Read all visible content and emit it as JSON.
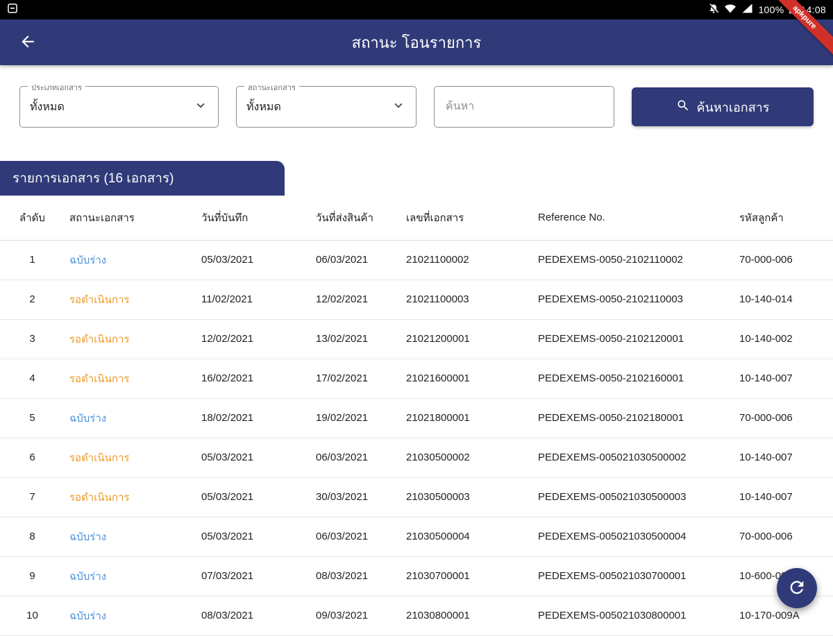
{
  "status_bar": {
    "battery_pct": "100%",
    "time": "14:08"
  },
  "ribbon": {
    "text": "apkpure"
  },
  "app_bar": {
    "title": "สถานะ โอนรายการ"
  },
  "filters": {
    "doc_type": {
      "label": "ประเภทเอกสาร",
      "value": "ทั้งหมด"
    },
    "doc_status": {
      "label": "สถานะเอกสาร",
      "value": "ทั้งหมด"
    },
    "search_placeholder": "ค้นหา",
    "search_button": "ค้นหาเอกสาร"
  },
  "section": {
    "title": "รายการเอกสาร (16 เอกสาร)"
  },
  "table": {
    "headers": [
      "ลำดับ",
      "สถานะเอกสาร",
      "วันที่บันทึก",
      "วันที่ส่งสินค้า",
      "เลขที่เอกสาร",
      "Reference No.",
      "รหัสลูกค้า"
    ],
    "rows": [
      {
        "no": "1",
        "status": "ฉบับร่าง",
        "status_type": "draft",
        "record_date": "05/03/2021",
        "ship_date": "06/03/2021",
        "doc_no": "21021100002",
        "reference": "PEDEXEMS-0050-2102110002",
        "customer": "70-000-006"
      },
      {
        "no": "2",
        "status": "รอดำเนินการ",
        "status_type": "pending",
        "record_date": "11/02/2021",
        "ship_date": "12/02/2021",
        "doc_no": "21021100003",
        "reference": "PEDEXEMS-0050-2102110003",
        "customer": "10-140-014"
      },
      {
        "no": "3",
        "status": "รอดำเนินการ",
        "status_type": "pending",
        "record_date": "12/02/2021",
        "ship_date": "13/02/2021",
        "doc_no": "21021200001",
        "reference": "PEDEXEMS-0050-2102120001",
        "customer": "10-140-002"
      },
      {
        "no": "4",
        "status": "รอดำเนินการ",
        "status_type": "pending",
        "record_date": "16/02/2021",
        "ship_date": "17/02/2021",
        "doc_no": "21021600001",
        "reference": "PEDEXEMS-0050-2102160001",
        "customer": "10-140-007"
      },
      {
        "no": "5",
        "status": "ฉบับร่าง",
        "status_type": "draft",
        "record_date": "18/02/2021",
        "ship_date": "19/02/2021",
        "doc_no": "21021800001",
        "reference": "PEDEXEMS-0050-2102180001",
        "customer": "70-000-006"
      },
      {
        "no": "6",
        "status": "รอดำเนินการ",
        "status_type": "pending",
        "record_date": "05/03/2021",
        "ship_date": "06/03/2021",
        "doc_no": "21030500002",
        "reference": "PEDEXEMS-005021030500002",
        "customer": "10-140-007"
      },
      {
        "no": "7",
        "status": "รอดำเนินการ",
        "status_type": "pending",
        "record_date": "05/03/2021",
        "ship_date": "30/03/2021",
        "doc_no": "21030500003",
        "reference": "PEDEXEMS-005021030500003",
        "customer": "10-140-007"
      },
      {
        "no": "8",
        "status": "ฉบับร่าง",
        "status_type": "draft",
        "record_date": "05/03/2021",
        "ship_date": "06/03/2021",
        "doc_no": "21030500004",
        "reference": "PEDEXEMS-005021030500004",
        "customer": "70-000-006"
      },
      {
        "no": "9",
        "status": "ฉบับร่าง",
        "status_type": "draft",
        "record_date": "07/03/2021",
        "ship_date": "08/03/2021",
        "doc_no": "21030700001",
        "reference": "PEDEXEMS-005021030700001",
        "customer": "10-600-001"
      },
      {
        "no": "10",
        "status": "ฉบับร่าง",
        "status_type": "draft",
        "record_date": "08/03/2021",
        "ship_date": "09/03/2021",
        "doc_no": "21030800001",
        "reference": "PEDEXEMS-005021030800001",
        "customer": "10-170-009A"
      }
    ]
  },
  "icons": {
    "back": "arrow-left",
    "dropdown": "chevron-down",
    "search": "magnifier",
    "refresh": "circular-arrow",
    "status_bar": [
      "notification",
      "mute",
      "wifi",
      "signal",
      "battery"
    ]
  },
  "colors": {
    "navy": "#303a78",
    "draft": "#4a90d9",
    "pending": "#f09a23",
    "ribbon": "#d13029"
  }
}
